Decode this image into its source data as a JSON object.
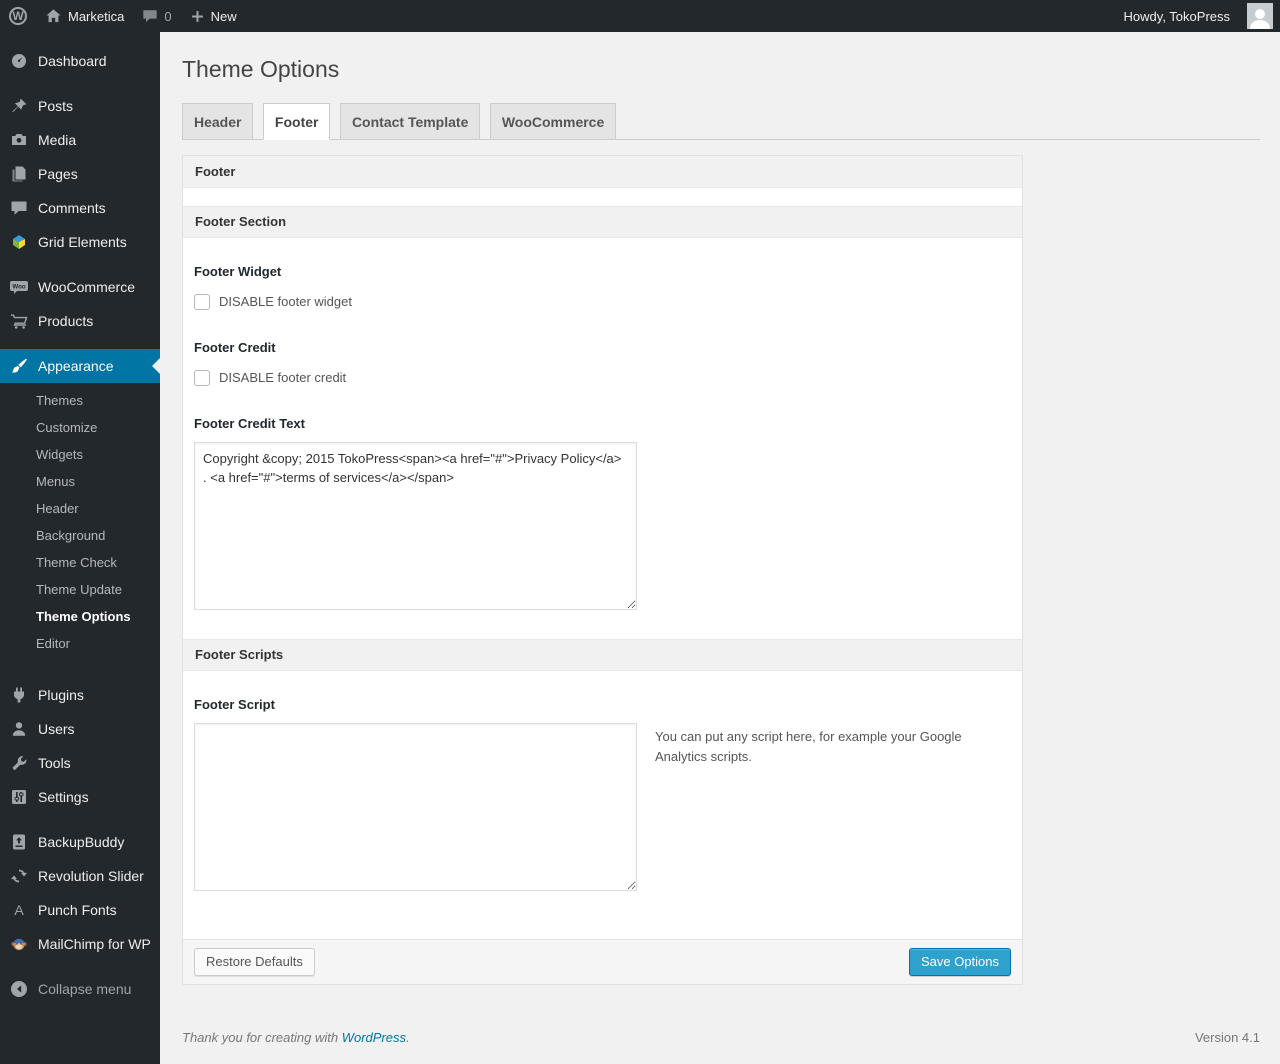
{
  "admin_bar": {
    "wp_logo": "W",
    "site_name": "Marketica",
    "comments_count": "0",
    "new_label": "New",
    "howdy": "Howdy, TokoPress"
  },
  "sidebar": {
    "items": [
      {
        "label": "Dashboard"
      },
      {
        "label": "Posts"
      },
      {
        "label": "Media"
      },
      {
        "label": "Pages"
      },
      {
        "label": "Comments"
      },
      {
        "label": "Grid Elements"
      },
      {
        "label": "WooCommerce"
      },
      {
        "label": "Products"
      },
      {
        "label": "Appearance"
      },
      {
        "label": "Plugins"
      },
      {
        "label": "Users"
      },
      {
        "label": "Tools"
      },
      {
        "label": "Settings"
      },
      {
        "label": "BackupBuddy"
      },
      {
        "label": "Revolution Slider"
      },
      {
        "label": "Punch Fonts"
      },
      {
        "label": "MailChimp for WP"
      }
    ],
    "appearance_submenu": [
      "Themes",
      "Customize",
      "Widgets",
      "Menus",
      "Header",
      "Background",
      "Theme Check",
      "Theme Update",
      "Theme Options",
      "Editor"
    ],
    "active_submenu_item": "Theme Options",
    "collapse_label": "Collapse menu"
  },
  "page": {
    "title": "Theme Options",
    "tabs": [
      {
        "label": "Header",
        "active": false
      },
      {
        "label": "Footer",
        "active": true
      },
      {
        "label": "Contact Template",
        "active": false
      },
      {
        "label": "WooCommerce",
        "active": false
      }
    ],
    "boxes": {
      "footer_title": "Footer",
      "footer_section_title": "Footer Section",
      "footer_scripts_title": "Footer Scripts"
    },
    "fields": {
      "footer_widget_label": "Footer Widget",
      "footer_widget_checkbox_label": "DISABLE footer widget",
      "footer_credit_label": "Footer Credit",
      "footer_credit_checkbox_label": "DISABLE footer credit",
      "footer_credit_text_label": "Footer Credit Text",
      "footer_credit_text_value": "Copyright &copy; 2015 TokoPress<span><a href=\"#\">Privacy Policy</a> . <a href=\"#\">terms of services</a></span>",
      "footer_script_label": "Footer Script",
      "footer_script_value": "",
      "footer_script_help": "You can put any script here, for example your Google Analytics scripts."
    },
    "actions": {
      "restore_label": "Restore Defaults",
      "save_label": "Save Options"
    }
  },
  "footer": {
    "thanks_prefix": "Thank you for creating with ",
    "wordpress_link_label": "WordPress",
    "thanks_suffix": ".",
    "version": "Version 4.1"
  },
  "colors": {
    "accent_blue": "#0074a2",
    "primary_button": "#2ea2cc",
    "admin_dark": "#23282d",
    "page_background": "#f1f1f1"
  }
}
